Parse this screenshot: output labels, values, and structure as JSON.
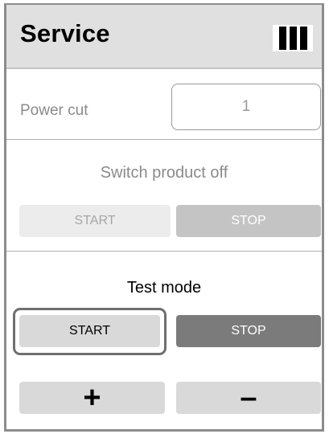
{
  "header": {
    "title": "Service",
    "status_icon": "signal-bars-icon"
  },
  "power_cut": {
    "label": "Power cut",
    "value": "1"
  },
  "switch_off": {
    "title": "Switch product off",
    "start_label": "START",
    "stop_label": "STOP"
  },
  "test_mode": {
    "title": "Test mode",
    "start_label": "START",
    "stop_label": "STOP",
    "plus_label": "+",
    "minus_label": "–"
  },
  "colors": {
    "header_bg": "#e0e0e0",
    "disabled_text": "#8a8a8a",
    "dark_button": "#7b7b7b",
    "light_button": "#d9d9d9"
  }
}
